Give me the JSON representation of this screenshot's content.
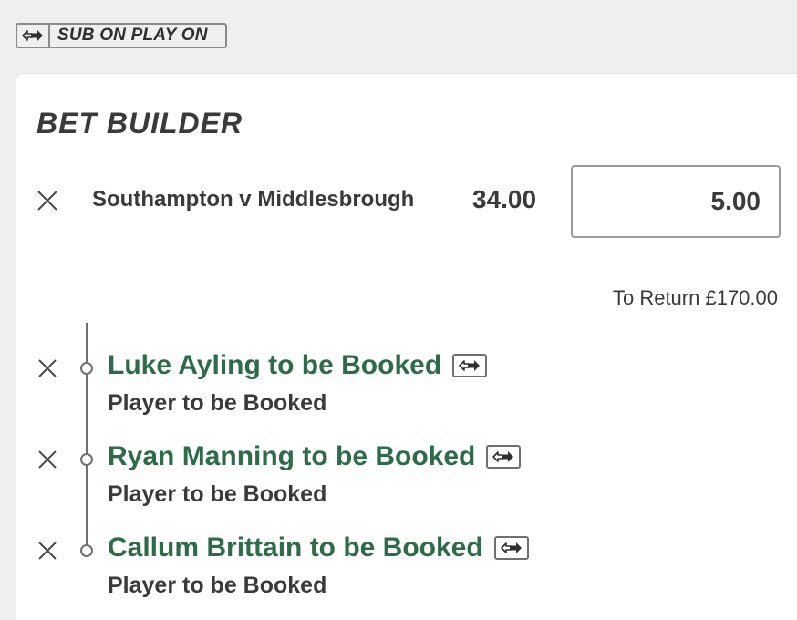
{
  "sub_on_play_on": {
    "label": "SUB ON PLAY ON",
    "icon": "swap-arrows-icon"
  },
  "bet_builder": {
    "title": "BET BUILDER",
    "event": "Southampton v Middlesbrough",
    "odds": "34.00",
    "stake": "5.00",
    "to_return": "To Return £170.00",
    "legs": [
      {
        "selection": "Luke Ayling to be Booked",
        "market": "Player to be Booked"
      },
      {
        "selection": "Ryan Manning to be Booked",
        "market": "Player to be Booked"
      },
      {
        "selection": "Callum Brittain to be Booked",
        "market": "Player to be Booked"
      }
    ]
  },
  "colors": {
    "selection_green": "#2e6b4a",
    "text_dark": "#3a3a3a",
    "background": "#efefef"
  }
}
